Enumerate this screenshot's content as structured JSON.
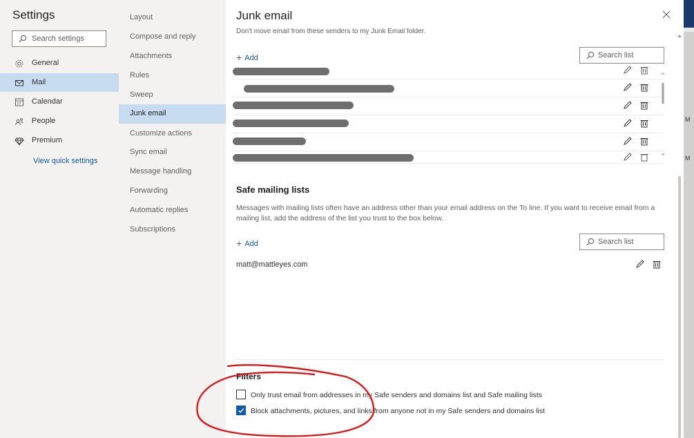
{
  "nav": {
    "title": "Settings",
    "search_placeholder": "Search settings",
    "categories": [
      {
        "label": "General",
        "icon": "gear-icon"
      },
      {
        "label": "Mail",
        "icon": "mail-icon"
      },
      {
        "label": "Calendar",
        "icon": "calendar-icon"
      },
      {
        "label": "People",
        "icon": "people-icon"
      },
      {
        "label": "Premium",
        "icon": "diamond-icon"
      }
    ],
    "quick_settings": "View quick settings"
  },
  "submenu": {
    "items": [
      "Layout",
      "Compose and reply",
      "Attachments",
      "Rules",
      "Sweep",
      "Junk email",
      "Customize actions",
      "Sync email",
      "Message handling",
      "Forwarding",
      "Automatic replies",
      "Subscriptions"
    ],
    "active": "Junk email"
  },
  "panel": {
    "title": "Junk email",
    "cut_text": "Don't move email from these senders to my Junk Email folder.",
    "add_label": "Add",
    "search_list_placeholder": "Search list",
    "safe_mailing": {
      "title": "Safe mailing lists",
      "description": "Messages with mailing lists often have an address other than your email address on the To line. If you want to receive email from a mailing list, add the address of the list you trust to the box below.",
      "add_label": "Add",
      "search_list_placeholder": "Search list",
      "entries": [
        "matt@mattleyes.com"
      ]
    },
    "filters": {
      "title": "Filters",
      "options": [
        {
          "label": "Only trust email from addresses in my Safe senders and domains list and Safe mailing lists",
          "checked": false
        },
        {
          "label": "Block attachments, pictures, and links from anyone not in my Safe senders and domains list",
          "checked": true
        }
      ]
    }
  },
  "edge": {
    "letters": [
      "M",
      "M"
    ]
  },
  "colors": {
    "accent": "#0f5aa8",
    "selected": "#c7dcf0",
    "annotation": "#d9191c"
  }
}
